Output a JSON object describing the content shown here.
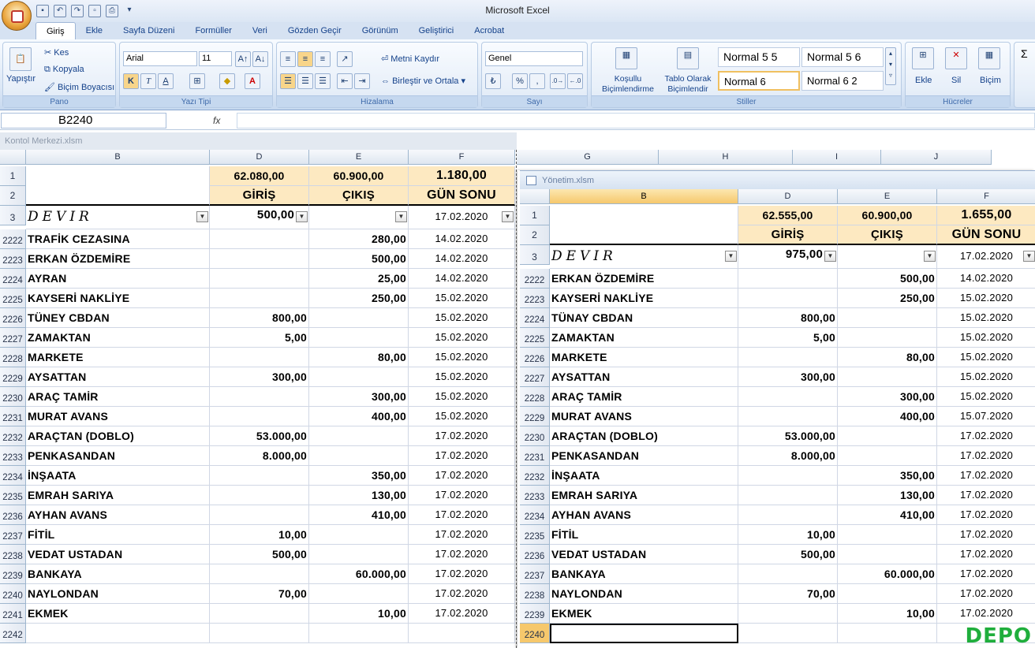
{
  "app": {
    "title": "Microsoft Excel"
  },
  "ribbon": {
    "tabs": [
      "Giriş",
      "Ekle",
      "Sayfa Düzeni",
      "Formüller",
      "Veri",
      "Gözden Geçir",
      "Görünüm",
      "Geliştirici",
      "Acrobat"
    ],
    "active_tab": "Giriş",
    "clipboard": {
      "paste": "Yapıştır",
      "cut": "Kes",
      "copy": "Kopyala",
      "format_painter": "Biçim Boyacısı",
      "label": "Pano"
    },
    "font": {
      "name": "Arial",
      "size": "11",
      "bold": "K",
      "italic": "T",
      "underline": "A",
      "label": "Yazı Tipi"
    },
    "alignment": {
      "wrap": "Metni Kaydır",
      "merge": "Birleştir ve Ortala",
      "label": "Hizalama"
    },
    "number": {
      "format": "Genel",
      "percent": "%",
      "comma": ",",
      "label": "Sayı"
    },
    "styles": {
      "conditional": "Koşullu Biçimlendirme",
      "table": "Tablo Olarak Biçimlendir",
      "items": [
        "Normal 5 5",
        "Normal 5 6",
        "Normal 6",
        "Normal 6 2"
      ],
      "label": "Stiller"
    },
    "cells": {
      "insert": "Ekle",
      "delete": "Sil",
      "format": "Biçim",
      "label": "Hücreler"
    },
    "editing": {
      "sigma": "Σ"
    }
  },
  "formula_bar": {
    "name_box": "B2240",
    "fx": "fx",
    "value": ""
  },
  "wb1": {
    "title": "Kontol Merkezi.xlsm",
    "cols": [
      "B",
      "D",
      "E",
      "F",
      "G",
      "H",
      "I",
      "J"
    ],
    "header": {
      "giris_total": "62.080,00",
      "cikis_total": "60.900,00",
      "gun_total": "1.180,00",
      "giris": "GİRİŞ",
      "cikis": "ÇIKIŞ",
      "gun": "GÜN SONU"
    },
    "devir": {
      "label": "DEVIR",
      "giris": "500,00",
      "date": "17.02.2020"
    },
    "top_rows": [
      "1",
      "2",
      "3"
    ],
    "rows": [
      {
        "n": "2222",
        "b": "TRAFİK CEZASINA",
        "d": "",
        "e": "280,00",
        "f": "14.02.2020"
      },
      {
        "n": "2223",
        "b": "ERKAN ÖZDEMİRE",
        "d": "",
        "e": "500,00",
        "f": "14.02.2020"
      },
      {
        "n": "2224",
        "b": "AYRAN",
        "d": "",
        "e": "25,00",
        "f": "14.02.2020"
      },
      {
        "n": "2225",
        "b": "KAYSERİ NAKLİYE",
        "d": "",
        "e": "250,00",
        "f": "15.02.2020"
      },
      {
        "n": "2226",
        "b": "TÜNEY CBDAN",
        "d": "800,00",
        "e": "",
        "f": "15.02.2020"
      },
      {
        "n": "2227",
        "b": "ZAMAKTAN",
        "d": "5,00",
        "e": "",
        "f": "15.02.2020"
      },
      {
        "n": "2228",
        "b": "MARKETE",
        "d": "",
        "e": "80,00",
        "f": "15.02.2020"
      },
      {
        "n": "2229",
        "b": "AYSATTAN",
        "d": "300,00",
        "e": "",
        "f": "15.02.2020"
      },
      {
        "n": "2230",
        "b": "ARAÇ TAMİR",
        "d": "",
        "e": "300,00",
        "f": "15.02.2020"
      },
      {
        "n": "2231",
        "b": "MURAT AVANS",
        "d": "",
        "e": "400,00",
        "f": "15.02.2020"
      },
      {
        "n": "2232",
        "b": "ARAÇTAN (DOBLO)",
        "d": "53.000,00",
        "e": "",
        "f": "17.02.2020"
      },
      {
        "n": "2233",
        "b": "PENKASANDAN",
        "d": "8.000,00",
        "e": "",
        "f": "17.02.2020"
      },
      {
        "n": "2234",
        "b": "İNŞAATA",
        "d": "",
        "e": "350,00",
        "f": "17.02.2020"
      },
      {
        "n": "2235",
        "b": "EMRAH SARIYA",
        "d": "",
        "e": "130,00",
        "f": "17.02.2020"
      },
      {
        "n": "2236",
        "b": "AYHAN AVANS",
        "d": "",
        "e": "410,00",
        "f": "17.02.2020"
      },
      {
        "n": "2237",
        "b": "FİTİL",
        "d": "10,00",
        "e": "",
        "f": "17.02.2020"
      },
      {
        "n": "2238",
        "b": "VEDAT USTADAN",
        "d": "500,00",
        "e": "",
        "f": "17.02.2020"
      },
      {
        "n": "2239",
        "b": "BANKAYA",
        "d": "",
        "e": "60.000,00",
        "f": "17.02.2020"
      },
      {
        "n": "2240",
        "b": "NAYLONDAN",
        "d": "70,00",
        "e": "",
        "f": "17.02.2020"
      },
      {
        "n": "2241",
        "b": "EKMEK",
        "d": "",
        "e": "10,00",
        "f": "17.02.2020"
      },
      {
        "n": "2242",
        "b": "",
        "d": "",
        "e": "",
        "f": ""
      }
    ]
  },
  "wb2": {
    "title": "Yönetim.xlsm",
    "cols": [
      "B",
      "D",
      "E",
      "F"
    ],
    "header": {
      "giris_total": "62.555,00",
      "cikis_total": "60.900,00",
      "gun_total": "1.655,00",
      "giris": "GİRİŞ",
      "cikis": "ÇIKIŞ",
      "gun": "GÜN SONU"
    },
    "devir": {
      "label": "DEVIR",
      "giris": "975,00",
      "date": "17.02.2020"
    },
    "top_rows": [
      "1",
      "2",
      "3"
    ],
    "rows": [
      {
        "n": "2222",
        "b": "ERKAN ÖZDEMİRE",
        "d": "",
        "e": "500,00",
        "f": "14.02.2020"
      },
      {
        "n": "2223",
        "b": "KAYSERİ NAKLİYE",
        "d": "",
        "e": "250,00",
        "f": "15.02.2020"
      },
      {
        "n": "2224",
        "b": "TÜNAY CBDAN",
        "d": "800,00",
        "e": "",
        "f": "15.02.2020"
      },
      {
        "n": "2225",
        "b": "ZAMAKTAN",
        "d": "5,00",
        "e": "",
        "f": "15.02.2020"
      },
      {
        "n": "2226",
        "b": "MARKETE",
        "d": "",
        "e": "80,00",
        "f": "15.02.2020"
      },
      {
        "n": "2227",
        "b": "AYSATTAN",
        "d": "300,00",
        "e": "",
        "f": "15.02.2020"
      },
      {
        "n": "2228",
        "b": "ARAÇ TAMİR",
        "d": "",
        "e": "300,00",
        "f": "15.02.2020"
      },
      {
        "n": "2229",
        "b": "MURAT AVANS",
        "d": "",
        "e": "400,00",
        "f": "15.07.2020"
      },
      {
        "n": "2230",
        "b": "ARAÇTAN (DOBLO)",
        "d": "53.000,00",
        "e": "",
        "f": "17.02.2020"
      },
      {
        "n": "2231",
        "b": "PENKASANDAN",
        "d": "8.000,00",
        "e": "",
        "f": "17.02.2020"
      },
      {
        "n": "2232",
        "b": "İNŞAATA",
        "d": "",
        "e": "350,00",
        "f": "17.02.2020"
      },
      {
        "n": "2233",
        "b": "EMRAH SARIYA",
        "d": "",
        "e": "130,00",
        "f": "17.02.2020"
      },
      {
        "n": "2234",
        "b": "AYHAN AVANS",
        "d": "",
        "e": "410,00",
        "f": "17.02.2020"
      },
      {
        "n": "2235",
        "b": "FİTİL",
        "d": "10,00",
        "e": "",
        "f": "17.02.2020"
      },
      {
        "n": "2236",
        "b": "VEDAT USTADAN",
        "d": "500,00",
        "e": "",
        "f": "17.02.2020"
      },
      {
        "n": "2237",
        "b": "BANKAYA",
        "d": "",
        "e": "60.000,00",
        "f": "17.02.2020"
      },
      {
        "n": "2238",
        "b": "NAYLONDAN",
        "d": "70,00",
        "e": "",
        "f": "17.02.2020"
      },
      {
        "n": "2239",
        "b": "EKMEK",
        "d": "",
        "e": "10,00",
        "f": "17.02.2020"
      },
      {
        "n": "2240",
        "b": "",
        "d": "",
        "e": "",
        "f": ""
      }
    ]
  },
  "watermark": "DEPO",
  "colors": {
    "header_fill": "#fde9c1",
    "selected_header": "#f6c86c",
    "ribbon_blue": "#15428b"
  }
}
